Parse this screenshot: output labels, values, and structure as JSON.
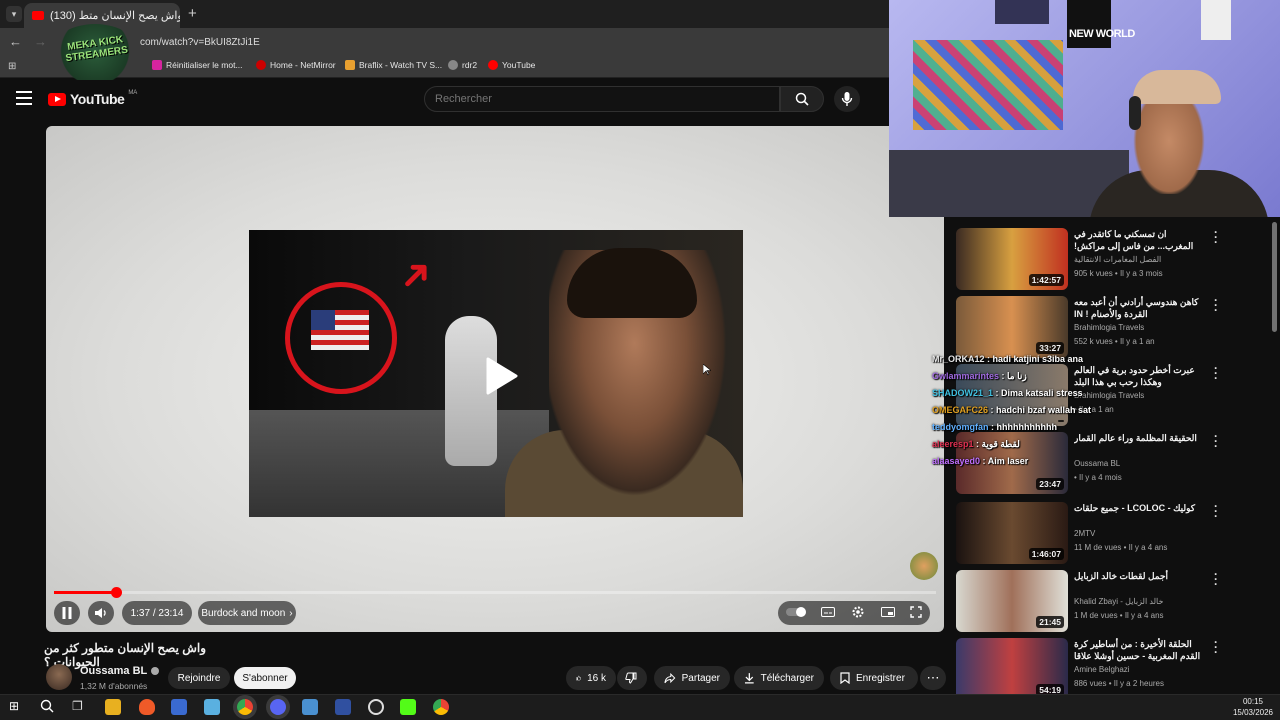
{
  "browser": {
    "tab_title": "(130) واش يصح الإنسان متط",
    "tab_close": "×",
    "new_tab": "+",
    "url": "com/watch?v=BkUI8ZtJi1E",
    "bookmarks": [
      "Réinitialiser le mot...",
      "Home - NetMirror",
      "Braflix - Watch TV S...",
      "rdr2",
      "YouTube"
    ]
  },
  "overlay_logo": {
    "text": "MEKA KICK STREAMERS"
  },
  "youtube": {
    "logo": "YouTube",
    "country": "MA",
    "search_placeholder": "Rechercher"
  },
  "player": {
    "current_time": "1:37",
    "duration": "23:14",
    "time_display": "1:37 / 23:14",
    "chapter": "Burdock and moon",
    "chapter_chevron": "›",
    "progress_fraction": 0.07
  },
  "video": {
    "title": "واش يصح الإنسان متطور كثر من الحيوانات ؟",
    "channel": "Oussama BL",
    "subscribers": "1,32 M d'abonnés",
    "join_label": "Rejoindre",
    "subscribe_label": "S'abonner",
    "likes": "16 k",
    "share_label": "Partager",
    "download_label": "Télécharger",
    "save_label": "Enregistrer",
    "more": "⋯"
  },
  "webcam": {
    "poster_text": "NEW WORLD"
  },
  "recommendations": [
    {
      "title": "ان تمسكني ما كاتقدر في المغرب... من فاس إلى مراكش!",
      "channel": "الفصل المغامرات الانتقالية",
      "meta": "905 k vues • Il y a 3 mois",
      "duration": "1:42:57"
    },
    {
      "title": "كاهن هندوسي أرادني أن أعبد معه القردة والأصنام ! IN",
      "channel": "Brahimlogia Travels",
      "meta": "552 k vues • Il y a 1 an",
      "duration": "33:27"
    },
    {
      "title": "عبرت أخطر حدود برية في العالم وهكذا رحب بي هذا البلد",
      "channel": "Brahimlogia Travels",
      "meta": "• Il y a 1 an",
      "duration": ""
    },
    {
      "title": "الحقيقة المظلمة وراء عالم القمار",
      "channel": "Oussama BL",
      "meta": "• Il y a 4 mois",
      "duration": "23:47"
    },
    {
      "title": "كوليك - LCOLOC - جميع حلقات",
      "channel": "2MTV",
      "meta": "11 M de vues • Il y a 4 ans",
      "duration": "1:46:07"
    },
    {
      "title": "أجمل لقطات خالد الزبايل",
      "channel": "Khalid Zbayi - خالد الزبايل",
      "meta": "1 M de vues • Il y a 4 ans",
      "duration": "21:45"
    },
    {
      "title": "الحلقة الأخيرة : من أساطير كرة القدم المغربية - حسين أوشلا علاقا بالضحك (و بالسب!) 😂",
      "channel": "Amine Belghazi",
      "meta": "886 vues • Il y a 2 heures",
      "duration": "54:19"
    }
  ],
  "chat": [
    {
      "user": "Mr_ORKA12",
      "msg": "hadi katjini s3iba ana",
      "color": "#e8e8e8"
    },
    {
      "user": "Gwlammarintes",
      "msg": "زنا ما",
      "color": "#a06ae0"
    },
    {
      "user": "SHADOW21_1",
      "msg": "Dima katsali stress",
      "color": "#40c0e0"
    },
    {
      "user": "OMEGAFC26",
      "msg": "hadchi bzaf wallah sat",
      "color": "#e0a020"
    },
    {
      "user": "teddyomgfan",
      "msg": "hhhhhhhhhhh",
      "color": "#60b0ff"
    },
    {
      "user": "aleeresp1",
      "msg": "لقطة قوية",
      "color": "#e03050"
    },
    {
      "user": "alaasayed0",
      "msg": "Aim laser",
      "color": "#c070ff"
    }
  ],
  "taskbar": {
    "time": "00:15",
    "date": "15/03/2026"
  },
  "colors": {
    "accent": "#ff0000",
    "background": "#0f0f0f"
  }
}
